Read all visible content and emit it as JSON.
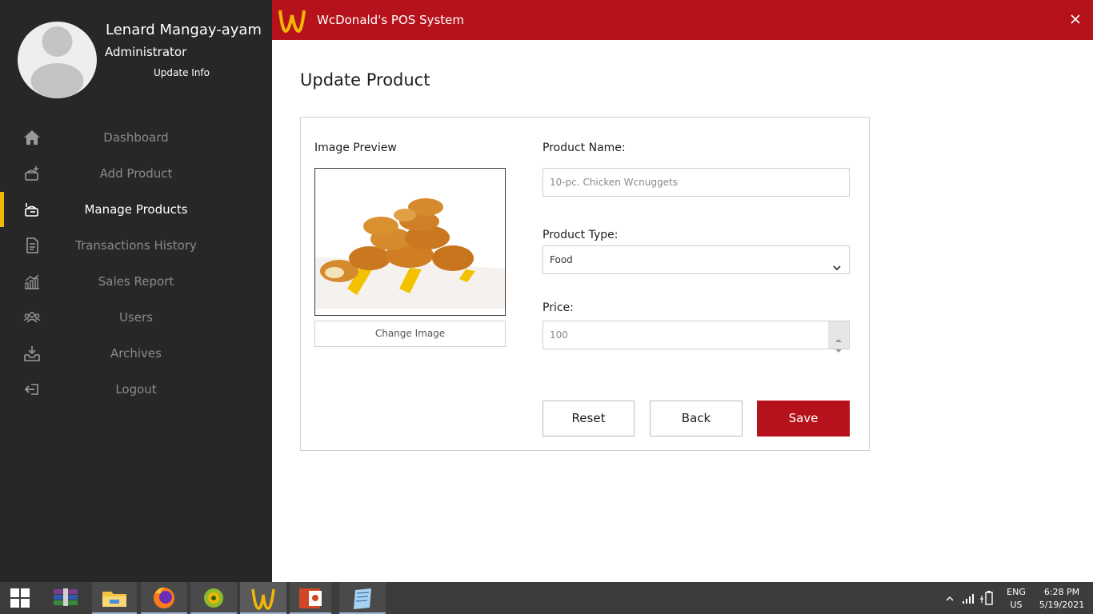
{
  "window": {
    "title": "WcDonald's POS System",
    "logo": "golden-arches-w-logo"
  },
  "user": {
    "name": "Lenard Mangay-ayam",
    "role": "Administrator",
    "update_link": "Update Info"
  },
  "nav": [
    {
      "label": "Dashboard",
      "icon": "home-icon",
      "active": false
    },
    {
      "label": "Add Product",
      "icon": "add-product-icon",
      "active": false
    },
    {
      "label": "Manage Products",
      "icon": "manage-products-icon",
      "active": true
    },
    {
      "label": "Transactions History",
      "icon": "document-icon",
      "active": false
    },
    {
      "label": "Sales Report",
      "icon": "chart-icon",
      "active": false
    },
    {
      "label": "Users",
      "icon": "users-icon",
      "active": false
    },
    {
      "label": "Archives",
      "icon": "archive-icon",
      "active": false
    },
    {
      "label": "Logout",
      "icon": "logout-icon",
      "active": false
    }
  ],
  "page": {
    "title": "Update Product",
    "image_preview_label": "Image Preview",
    "change_image_label": "Change Image",
    "product_name_label": "Product Name:",
    "product_name_value": "10-pc. Chicken Wcnuggets",
    "product_type_label": "Product Type:",
    "product_type_value": "Food",
    "price_label": "Price:",
    "price_value": "100",
    "reset_label": "Reset",
    "back_label": "Back",
    "save_label": "Save"
  },
  "taskbar": {
    "apps": [
      "winrar-icon",
      "file-explorer-icon",
      "firefox-icon",
      "chameleon-app-icon",
      "wcdonalds-pos-icon",
      "powerpoint-icon",
      "notepad-icon"
    ],
    "language_line1": "ENG",
    "language_line2": "US",
    "time": "6:28 PM",
    "date": "5/19/2021"
  },
  "colors": {
    "brand_red": "#b5121b",
    "sidebar_bg": "#272727",
    "active_indicator": "#f2b705",
    "logo_yellow": "#f2b705"
  }
}
